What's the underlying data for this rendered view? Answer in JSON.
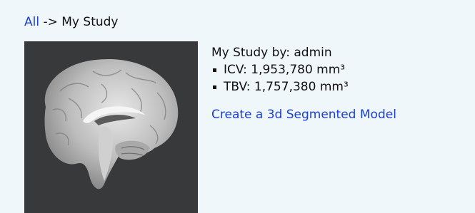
{
  "breadcrumb": {
    "root_link": "All",
    "separator": " -> ",
    "current": "My Study"
  },
  "study": {
    "owner_line": "My Study by: admin",
    "stats": [
      {
        "text": "ICV: 1,953,780 mm³"
      },
      {
        "text": "TBV: 1,757,380 mm³"
      }
    ],
    "create_link": "Create a 3d Segmented Model"
  },
  "colors": {
    "background": "#f0f7fb",
    "link": "#1a3fd1",
    "thumbnail_background": "#37393a"
  }
}
